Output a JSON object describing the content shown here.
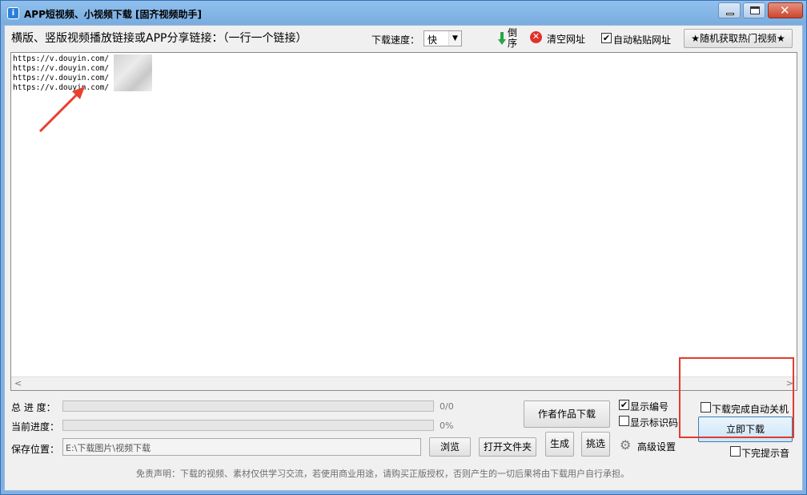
{
  "window": {
    "title": "APP短视频、小视频下载 [固齐视频助手]"
  },
  "top": {
    "instructions": "横版、竖版视频播放链接或APP分享链接：（一行一个链接）",
    "speed_label": "下载速度：",
    "speed_value": "快",
    "reverse_label": "倒序",
    "clear_label": "清空网址",
    "auto_paste_label": "自动粘贴网址",
    "auto_paste_checked": "✔",
    "hot_button": "★随机获取热门视频★"
  },
  "links": [
    "https://v.douyin.com/",
    "https://v.douyin.com/",
    "https://v.douyin.com/",
    "https://v.douyin.com/"
  ],
  "scroll": {
    "left": "<",
    "right": ">"
  },
  "progress": {
    "total_label": "总 进 度：",
    "total_value": "0/0",
    "current_label": "当前进度：",
    "current_value": "0%"
  },
  "save": {
    "label": "保存位置：",
    "path": "E:\\下载图片\\视频下载",
    "browse": "浏览",
    "open_folder": "打开文件夹"
  },
  "actions": {
    "author": "作者作品下载",
    "generate": "生成",
    "pick": "挑选",
    "show_number": "显示编号",
    "show_number_checked": "✔",
    "show_id": "显示标识码",
    "advanced": "高级设置"
  },
  "download_panel": {
    "shutdown": "下载完成自动关机",
    "start": "立即下载",
    "sound": "下完提示音"
  },
  "disclaimer": "免责声明：下载的视频、素材仅供学习交流，若使用商业用途，请购买正版授权，否则产生的一切后果将由下载用户自行承担。",
  "colors": {
    "titlebar": "#7fb1e4",
    "highlight_red": "#e23b2e",
    "progress_green": "#06b025"
  }
}
